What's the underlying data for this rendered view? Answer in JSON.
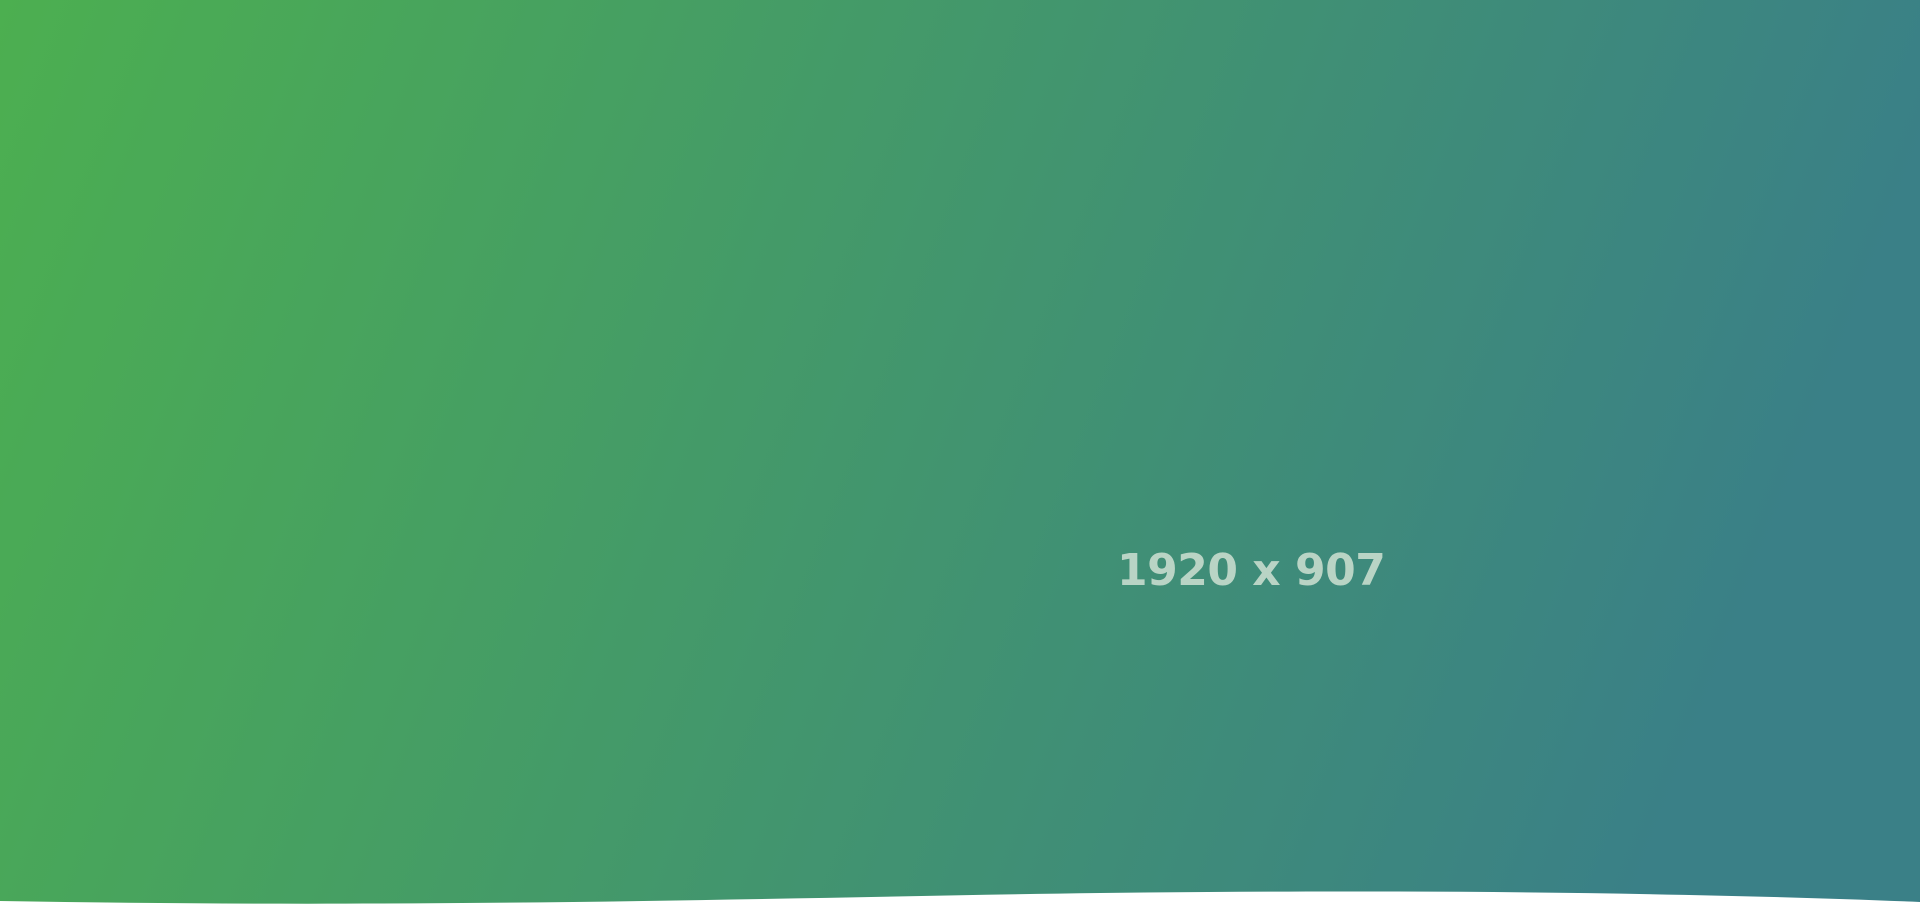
{
  "placeholder": {
    "label": "1920 x 907",
    "label_color": "#B9D4C5",
    "gradient_start": "#4CAF50",
    "gradient_end": "#3A8087",
    "background": "#FFFFFF"
  }
}
